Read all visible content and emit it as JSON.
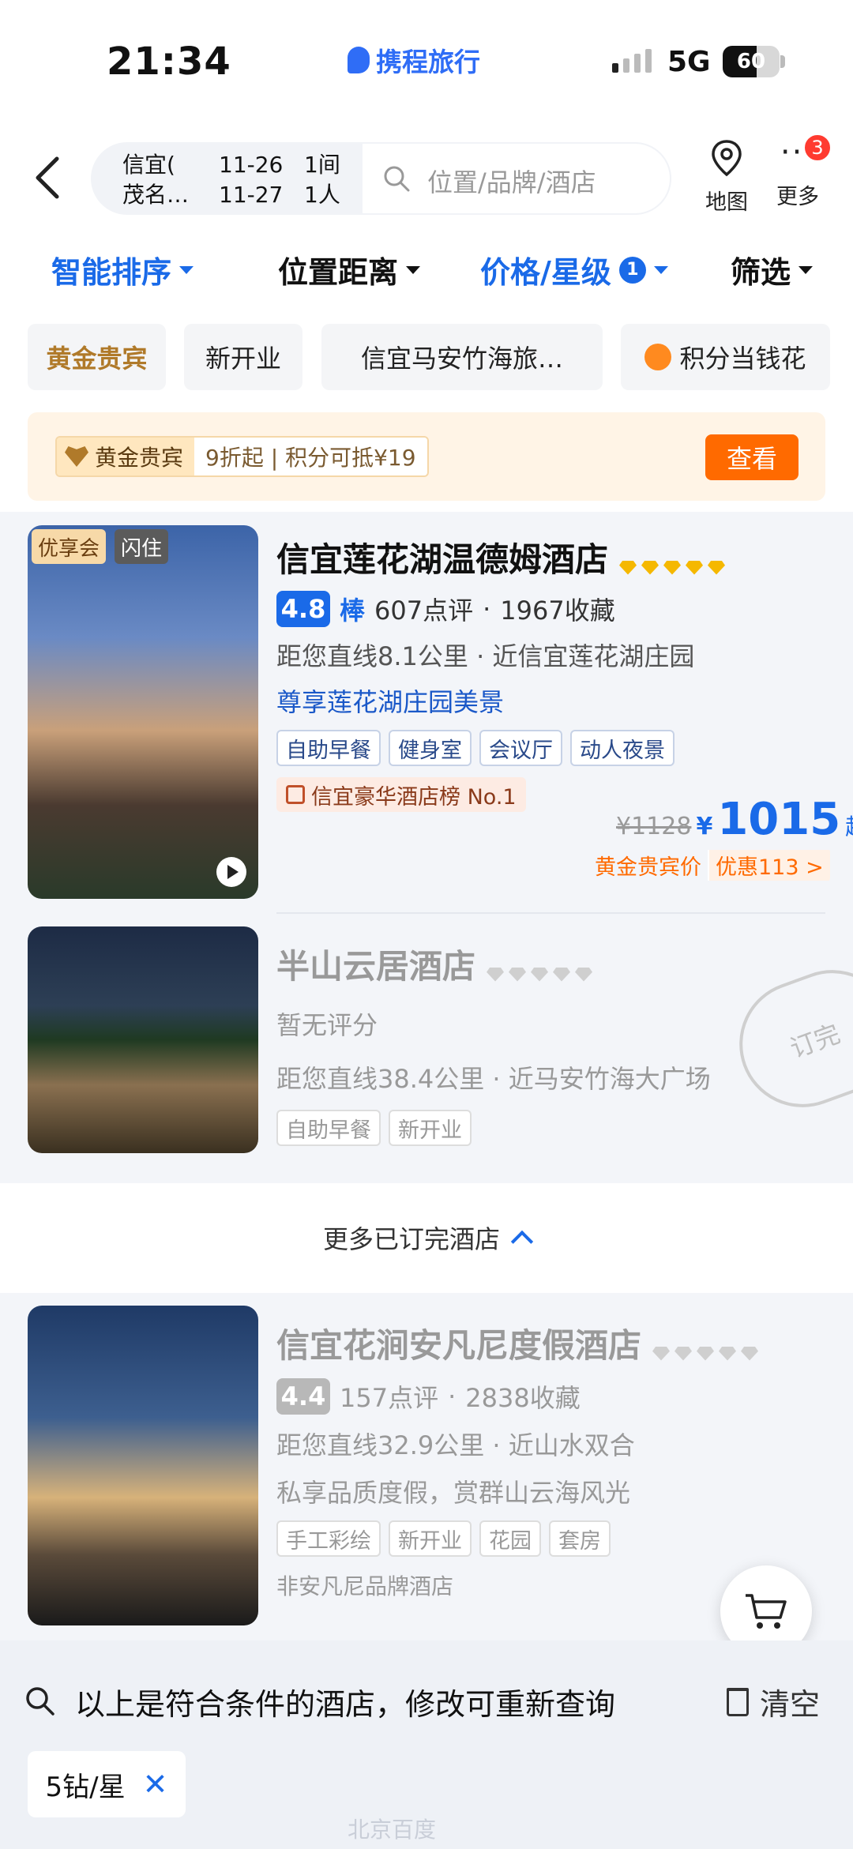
{
  "status": {
    "time": "21:34",
    "network": "5G",
    "battery": "60"
  },
  "app": {
    "logo": "携程旅行"
  },
  "search": {
    "city": "信宜(\n茂名…",
    "dates": "11-26\n11-27",
    "rooms": "1间\n1人",
    "placeholder": "位置/品牌/酒店"
  },
  "top_actions": {
    "map": "地图",
    "more": "更多",
    "more_badge": "3"
  },
  "sort_bar": {
    "smart": "智能排序",
    "distance": "位置距离",
    "price": "价格/星级",
    "price_badge": "1",
    "filter": "筛选"
  },
  "chips": [
    "黄金贵宾",
    "新开业",
    "信宜马安竹海旅…",
    "积分当钱花"
  ],
  "gold_banner": {
    "tag": "黄金贵宾",
    "desc": "9折起 | 积分可抵¥19",
    "button": "查看"
  },
  "hotels": [
    {
      "tags": [
        "优享会",
        "闪住"
      ],
      "name": "信宜莲花湖温德姆酒店",
      "score": "4.8",
      "score_word": "棒",
      "reviews": "607点评",
      "favs": "1967收藏",
      "distance": "距您直线8.1公里 · 近信宜莲花湖庄园",
      "promo": "尊享莲花湖庄园美景",
      "features": [
        "自助早餐",
        "健身室",
        "会议厅",
        "动人夜景"
      ],
      "rank": "信宜豪华酒店榜 No.1",
      "price_old": "¥1128",
      "currency": "¥",
      "price": "1015",
      "price_suffix": "起",
      "member_price": "黄金贵宾价",
      "discount": "优惠113 >"
    },
    {
      "name": "半山云居酒店",
      "score_text": "暂无评分",
      "distance": "距您直线38.4公里 · 近马安竹海大广场",
      "features": [
        "自助早餐",
        "新开业"
      ],
      "stamp": "订完"
    },
    {
      "name": "信宜花涧安凡尼度假酒店",
      "score": "4.4",
      "reviews": "157点评",
      "favs": "2838收藏",
      "distance": "距您直线32.9公里 · 近山水双合",
      "promo": "私享品质度假，赏群山云海风光",
      "features": [
        "手工彩绘",
        "新开业",
        "花园",
        "套房"
      ],
      "note": "非安凡尼品牌酒店"
    }
  ],
  "more_booked": "更多已订完酒店",
  "bottom": {
    "hint": "以上是符合条件的酒店，修改可重新查询",
    "clear": "清空",
    "filter_chip": "5钻/星",
    "remove": "✕"
  },
  "watermark": "北京百度"
}
